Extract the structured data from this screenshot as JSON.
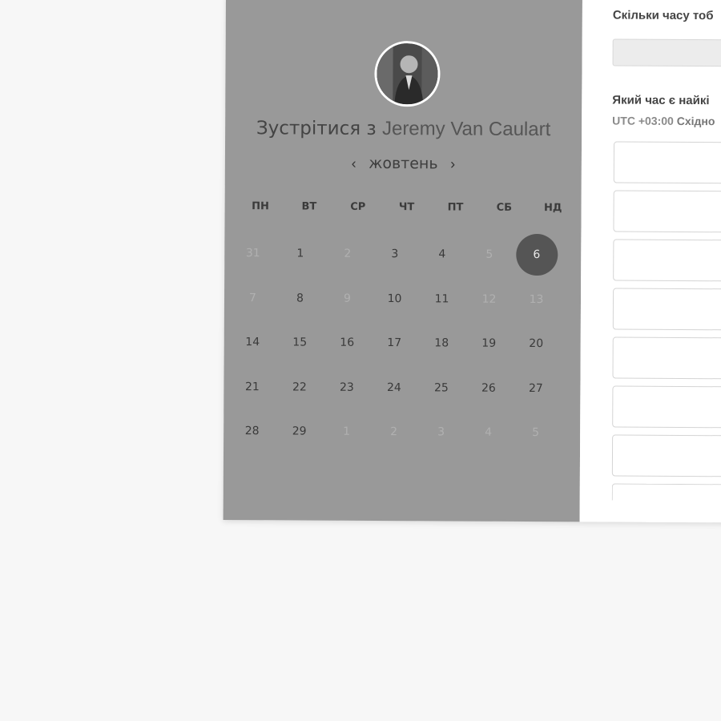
{
  "scheduler": {
    "title_prefix": "Зустрітися з",
    "host_name": "Jeremy Van Caulart",
    "month": "жовтень",
    "prev_icon": "‹",
    "next_icon": "›",
    "weekdays": [
      "ПН",
      "ВТ",
      "СР",
      "ЧТ",
      "ПТ",
      "СБ",
      "НД"
    ],
    "weeks": [
      [
        {
          "d": "31",
          "state": "muted"
        },
        {
          "d": "1",
          "state": "active"
        },
        {
          "d": "2",
          "state": "muted"
        },
        {
          "d": "3",
          "state": "active"
        },
        {
          "d": "4",
          "state": "active"
        },
        {
          "d": "5",
          "state": "muted"
        },
        {
          "d": "6",
          "state": "selected"
        }
      ],
      [
        {
          "d": "7",
          "state": "muted"
        },
        {
          "d": "8",
          "state": "active"
        },
        {
          "d": "9",
          "state": "muted"
        },
        {
          "d": "10",
          "state": "active"
        },
        {
          "d": "11",
          "state": "active"
        },
        {
          "d": "12",
          "state": "muted"
        },
        {
          "d": "13",
          "state": "muted"
        }
      ],
      [
        {
          "d": "14",
          "state": "active"
        },
        {
          "d": "15",
          "state": "active"
        },
        {
          "d": "16",
          "state": "active"
        },
        {
          "d": "17",
          "state": "active"
        },
        {
          "d": "18",
          "state": "active"
        },
        {
          "d": "19",
          "state": "active"
        },
        {
          "d": "20",
          "state": "active"
        }
      ],
      [
        {
          "d": "21",
          "state": "active"
        },
        {
          "d": "22",
          "state": "active"
        },
        {
          "d": "23",
          "state": "active"
        },
        {
          "d": "24",
          "state": "active"
        },
        {
          "d": "25",
          "state": "active"
        },
        {
          "d": "26",
          "state": "active"
        },
        {
          "d": "27",
          "state": "active"
        }
      ],
      [
        {
          "d": "28",
          "state": "active"
        },
        {
          "d": "29",
          "state": "active"
        },
        {
          "d": "1",
          "state": "muted"
        },
        {
          "d": "2",
          "state": "muted"
        },
        {
          "d": "3",
          "state": "muted"
        },
        {
          "d": "4",
          "state": "muted"
        },
        {
          "d": "5",
          "state": "muted"
        }
      ]
    ]
  },
  "form": {
    "duration_question": "Скільки часу тоб",
    "time_question": "Який час є найкі",
    "tz_offset": "UTC +03:00",
    "tz_name": "Східно",
    "slot_count": 8
  },
  "colors": {
    "left_panel": "#999999",
    "selected_day": "#555555",
    "page_bg": "#f7f7f7"
  }
}
